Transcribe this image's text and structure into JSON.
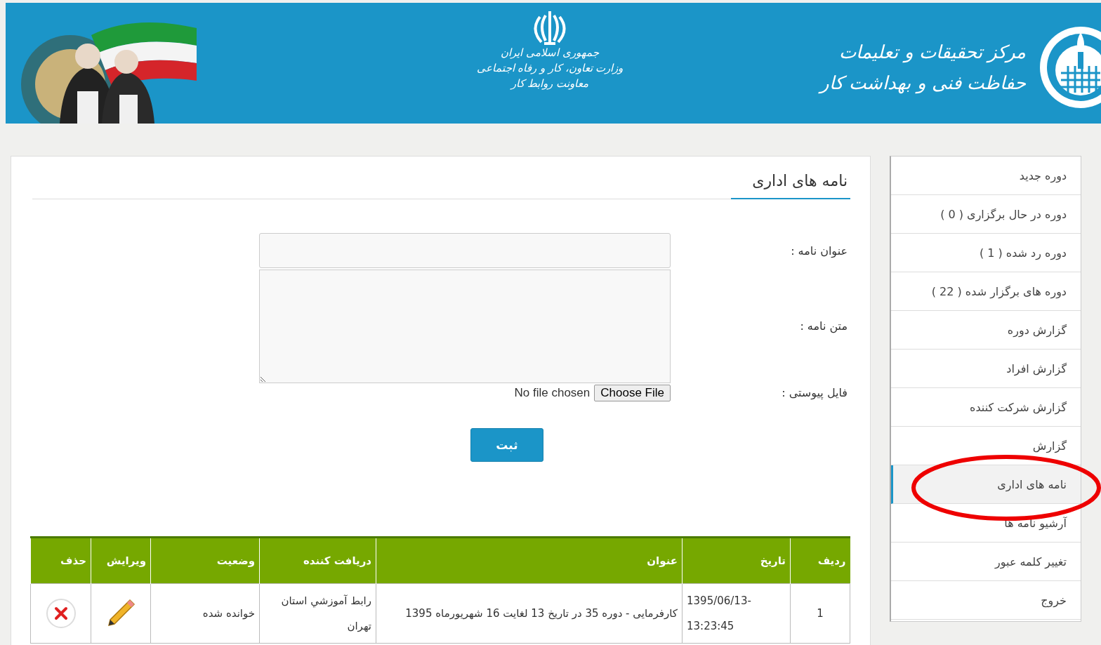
{
  "header": {
    "org_lines": [
      "مرکز تحقیقات و تعلیمات",
      "حفاظت فنی و بهداشت کار"
    ],
    "ministry_lines": [
      "جمهوری اسلامی ایران",
      "وزارت تعاون، کار و رفاه اجتماعی",
      "معاونت روابط کار"
    ],
    "banner": {
      "kind": "picture"
    }
  },
  "sidebar": {
    "items": [
      {
        "label": "دوره جدید",
        "selected": false
      },
      {
        "label": "دوره در حال برگزاری ( 0 )",
        "selected": false
      },
      {
        "label": "دوره رد شده ( 1 )",
        "selected": false
      },
      {
        "label": "دوره های برگزار شده ( 22 )",
        "selected": false
      },
      {
        "label": "گزارش دوره",
        "selected": false
      },
      {
        "label": "گزارش افراد",
        "selected": false
      },
      {
        "label": "گزارش شرکت کننده",
        "selected": false
      },
      {
        "label": "گزارش",
        "selected": false
      },
      {
        "label": "نامه های اداری",
        "selected": true
      },
      {
        "label": "آرشیو نامه ها",
        "selected": false
      },
      {
        "label": "تغییر کلمه عبور",
        "selected": false
      },
      {
        "label": "خروج",
        "selected": false
      }
    ]
  },
  "main": {
    "title": "نامه های اداری",
    "form": {
      "subject_label": "عنوان نامه :",
      "body_label": "متن نامه :",
      "attachment_label": "فایل پیوستی :",
      "file_button": "Choose File",
      "file_status": "No file chosen",
      "submit": "ثبت"
    },
    "table": {
      "columns": [
        "ردیف",
        "تاریخ",
        "عنوان",
        "دریافت کننده",
        "وضعیت",
        "ویرایش",
        "حذف"
      ],
      "rows": [
        {
          "index": "1",
          "date": "1395/06/13-13:23:45",
          "title": "کارفرمایی - دوره 35 در تاریخ 13 لغایت 16 شهریورماه 1395",
          "recipient": "رابط آموزشي استان تهران",
          "status": "خوانده شده"
        }
      ]
    }
  }
}
